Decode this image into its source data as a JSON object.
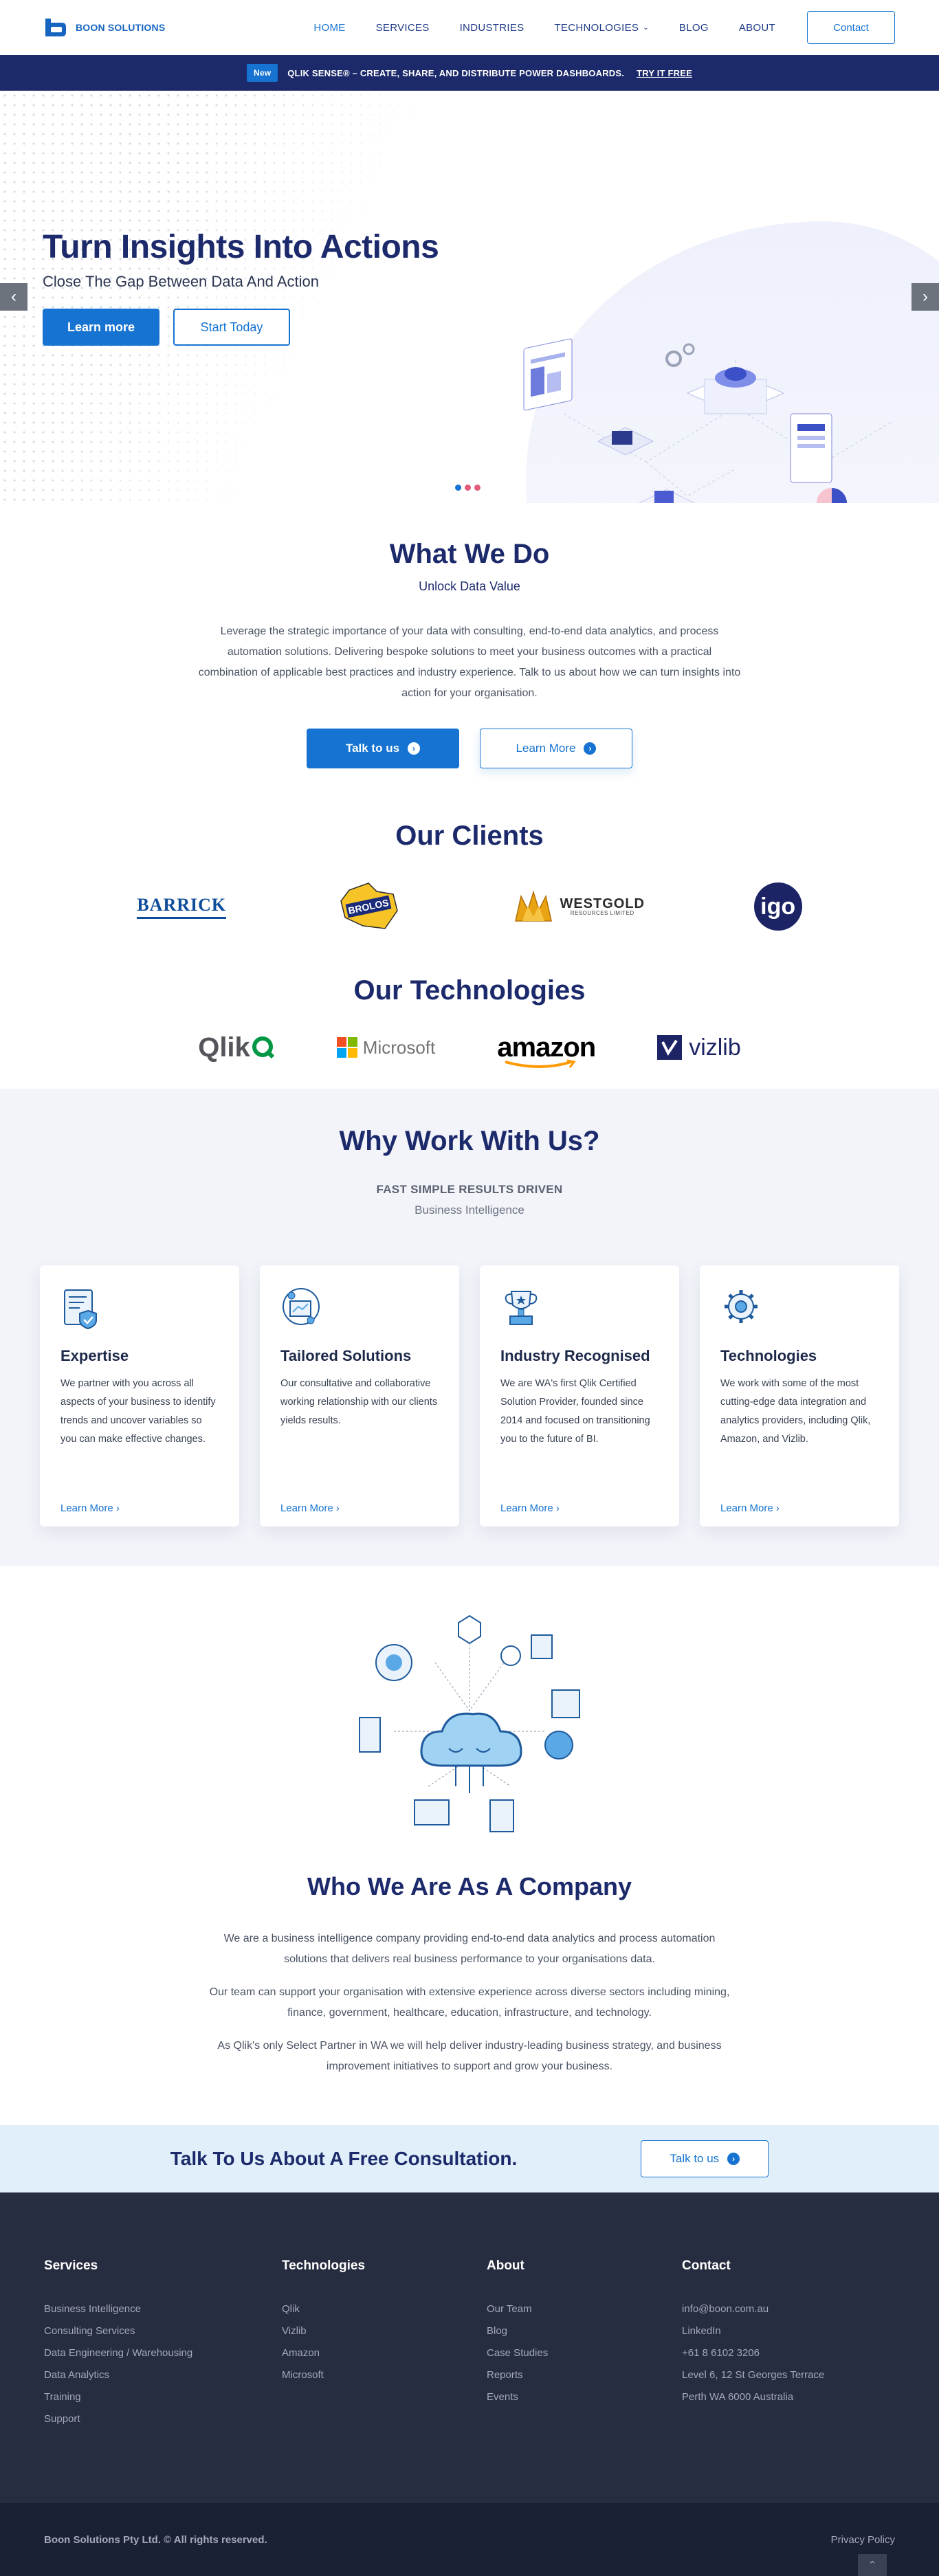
{
  "brand": {
    "name": "BOON SOLUTIONS"
  },
  "nav": {
    "items": [
      {
        "label": "HOME"
      },
      {
        "label": "SERVICES"
      },
      {
        "label": "INDUSTRIES"
      },
      {
        "label": "TECHNOLOGIES"
      },
      {
        "label": "BLOG"
      },
      {
        "label": "ABOUT"
      }
    ],
    "contact": "Contact"
  },
  "banner": {
    "badge": "New",
    "text": "QLIK SENSE® – CREATE, SHARE, AND DISTRIBUTE POWER DASHBOARDS.",
    "link": "TRY IT FREE"
  },
  "hero": {
    "title": "Turn Insights Into Actions",
    "subtitle": "Close The Gap Between Data And Action",
    "primary_btn": "Learn more",
    "secondary_btn": "Start Today",
    "prev": "‹",
    "next": "›"
  },
  "what": {
    "title": "What We Do",
    "subtitle": "Unlock Data Value",
    "body": "Leverage the strategic importance of your data with consulting, end-to-end data analytics, and process automation solutions. Delivering bespoke solutions to meet your business outcomes with a practical combination of applicable best practices and industry experience. Talk to us about how we can turn insights into action for your organisation.",
    "btn_talk": "Talk to us",
    "btn_learn": "Learn More"
  },
  "clients": {
    "title": "Our Clients",
    "logos": [
      "BARRICK",
      "BROLOS",
      "WESTGOLD",
      "RESOURCES LIMITED",
      "igo"
    ]
  },
  "technologies": {
    "title": "Our Technologies",
    "logos": [
      "Qlik",
      "Microsoft",
      "amazon",
      "vizlib"
    ]
  },
  "why": {
    "title": "Why Work With Us?",
    "eyebrow": "FAST SIMPLE RESULTS DRIVEN",
    "eyebrow2": "Business Intelligence",
    "cards": [
      {
        "title": "Expertise",
        "body": "We partner with you across all aspects of your business to identify trends and uncover variables so you can make effective changes.",
        "link": "Learn More ›"
      },
      {
        "title": "Tailored Solutions",
        "body": "Our consultative and collaborative working relationship with our clients yields results.",
        "link": "Learn More ›"
      },
      {
        "title": "Industry Recognised",
        "body": "We are WA's first Qlik Certified Solution Provider, founded since 2014 and focused on transitioning you to the future of BI.",
        "link": "Learn More ›"
      },
      {
        "title": "Technologies",
        "body": "We work with some of the most cutting-edge data integration and analytics providers, including Qlik, Amazon, and Vizlib.",
        "link": "Learn More ›"
      }
    ]
  },
  "who": {
    "title": "Who We Are As A Company",
    "p1": "We are a business intelligence company providing end-to-end data analytics and process automation solutions that delivers real business performance to your organisations data.",
    "p2": "Our team can support your organisation with extensive experience across diverse sectors including mining, finance, government, healthcare, education, infrastructure, and technology.",
    "p3": "As Qlik's only Select Partner in WA we will help deliver industry-leading business strategy, and business improvement initiatives to support and grow your business."
  },
  "cta": {
    "text": "Talk To Us About A Free Consultation.",
    "btn": "Talk to us"
  },
  "footer": {
    "services": {
      "title": "Services",
      "links": [
        "Business Intelligence",
        "Consulting Services",
        "Data Engineering / Warehousing",
        "Data Analytics",
        "Training",
        "Support"
      ]
    },
    "technologies": {
      "title": "Technologies",
      "links": [
        "Qlik",
        "Vizlib",
        "Amazon",
        "Microsoft"
      ]
    },
    "about": {
      "title": "About",
      "links": [
        "Our Team",
        "Blog",
        "Case Studies",
        "Reports",
        "Events"
      ]
    },
    "contact": {
      "title": "Contact",
      "links": [
        "info@boon.com.au",
        "LinkedIn",
        "+61 8 6102 3206",
        "Level 6, 12 St Georges Terrace",
        "Perth WA 6000 Australia"
      ]
    },
    "copyright": "Boon Solutions Pty Ltd. © All rights reserved.",
    "privacy": "Privacy Policy",
    "top": "⌃"
  },
  "colors": {
    "brand_blue": "#1673d1",
    "navy": "#1c2a6b",
    "footer_bg": "#262d40",
    "footer_bottom": "#1b2134",
    "cta_bg": "#e1effa",
    "why_bg": "#f2f4fa"
  }
}
